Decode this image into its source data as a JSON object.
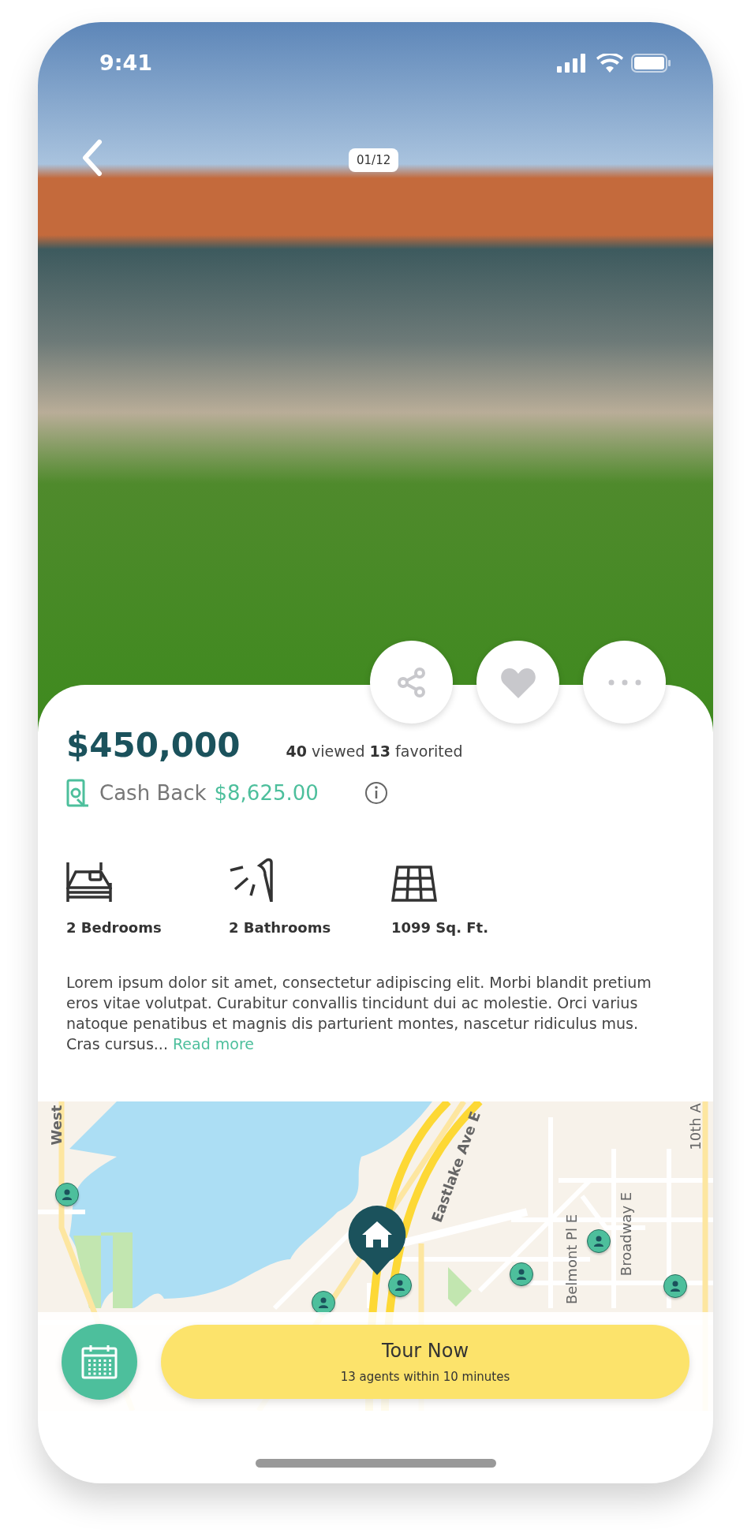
{
  "status_bar": {
    "time": "9:41"
  },
  "gallery": {
    "counter": "01/12"
  },
  "actions": [
    {
      "kind": "share"
    },
    {
      "kind": "favorite"
    },
    {
      "kind": "more"
    }
  ],
  "listing": {
    "price": "$450,000",
    "stats": "**40** viewed **13** favorited",
    "cash_back_label": "Cash Back",
    "cash_back_amount": "$8,625.00"
  },
  "features": [
    {
      "kind": "bed",
      "label": "2 Bedrooms"
    },
    {
      "kind": "bath",
      "label": "2 Bathrooms"
    },
    {
      "kind": "area",
      "label": "1099 Sq. Ft."
    }
  ],
  "description": {
    "text": "Lorem ipsum dolor sit amet, consectetur adipiscing elit. Morbi blandit pretium eros vitae volutpat. Curabitur convallis tincidunt dui ac molestie. Orci varius natoque penatibus et magnis dis parturient montes, nascetur ridiculus mus. Cras cursus...",
    "read_more": "Read more"
  },
  "map": {
    "streets": [
      "West",
      "Eastlake Ave E",
      "Belmont Pl E",
      "Broadway E",
      "10th A"
    ]
  },
  "tour": {
    "title": "Tour Now",
    "subtitle": "13 agents within 10 minutes"
  }
}
